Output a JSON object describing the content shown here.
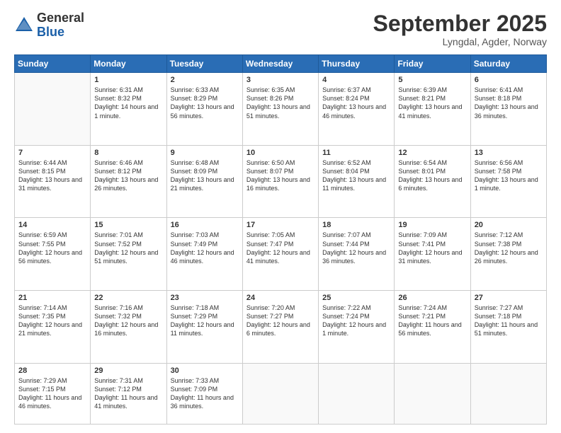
{
  "header": {
    "logo": {
      "general": "General",
      "blue": "Blue"
    },
    "title": "September 2025",
    "location": "Lyngdal, Agder, Norway"
  },
  "days_of_week": [
    "Sunday",
    "Monday",
    "Tuesday",
    "Wednesday",
    "Thursday",
    "Friday",
    "Saturday"
  ],
  "weeks": [
    [
      {
        "day": "",
        "sunrise": "",
        "sunset": "",
        "daylight": ""
      },
      {
        "day": "1",
        "sunrise": "Sunrise: 6:31 AM",
        "sunset": "Sunset: 8:32 PM",
        "daylight": "Daylight: 14 hours and 1 minute."
      },
      {
        "day": "2",
        "sunrise": "Sunrise: 6:33 AM",
        "sunset": "Sunset: 8:29 PM",
        "daylight": "Daylight: 13 hours and 56 minutes."
      },
      {
        "day": "3",
        "sunrise": "Sunrise: 6:35 AM",
        "sunset": "Sunset: 8:26 PM",
        "daylight": "Daylight: 13 hours and 51 minutes."
      },
      {
        "day": "4",
        "sunrise": "Sunrise: 6:37 AM",
        "sunset": "Sunset: 8:24 PM",
        "daylight": "Daylight: 13 hours and 46 minutes."
      },
      {
        "day": "5",
        "sunrise": "Sunrise: 6:39 AM",
        "sunset": "Sunset: 8:21 PM",
        "daylight": "Daylight: 13 hours and 41 minutes."
      },
      {
        "day": "6",
        "sunrise": "Sunrise: 6:41 AM",
        "sunset": "Sunset: 8:18 PM",
        "daylight": "Daylight: 13 hours and 36 minutes."
      }
    ],
    [
      {
        "day": "7",
        "sunrise": "Sunrise: 6:44 AM",
        "sunset": "Sunset: 8:15 PM",
        "daylight": "Daylight: 13 hours and 31 minutes."
      },
      {
        "day": "8",
        "sunrise": "Sunrise: 6:46 AM",
        "sunset": "Sunset: 8:12 PM",
        "daylight": "Daylight: 13 hours and 26 minutes."
      },
      {
        "day": "9",
        "sunrise": "Sunrise: 6:48 AM",
        "sunset": "Sunset: 8:09 PM",
        "daylight": "Daylight: 13 hours and 21 minutes."
      },
      {
        "day": "10",
        "sunrise": "Sunrise: 6:50 AM",
        "sunset": "Sunset: 8:07 PM",
        "daylight": "Daylight: 13 hours and 16 minutes."
      },
      {
        "day": "11",
        "sunrise": "Sunrise: 6:52 AM",
        "sunset": "Sunset: 8:04 PM",
        "daylight": "Daylight: 13 hours and 11 minutes."
      },
      {
        "day": "12",
        "sunrise": "Sunrise: 6:54 AM",
        "sunset": "Sunset: 8:01 PM",
        "daylight": "Daylight: 13 hours and 6 minutes."
      },
      {
        "day": "13",
        "sunrise": "Sunrise: 6:56 AM",
        "sunset": "Sunset: 7:58 PM",
        "daylight": "Daylight: 13 hours and 1 minute."
      }
    ],
    [
      {
        "day": "14",
        "sunrise": "Sunrise: 6:59 AM",
        "sunset": "Sunset: 7:55 PM",
        "daylight": "Daylight: 12 hours and 56 minutes."
      },
      {
        "day": "15",
        "sunrise": "Sunrise: 7:01 AM",
        "sunset": "Sunset: 7:52 PM",
        "daylight": "Daylight: 12 hours and 51 minutes."
      },
      {
        "day": "16",
        "sunrise": "Sunrise: 7:03 AM",
        "sunset": "Sunset: 7:49 PM",
        "daylight": "Daylight: 12 hours and 46 minutes."
      },
      {
        "day": "17",
        "sunrise": "Sunrise: 7:05 AM",
        "sunset": "Sunset: 7:47 PM",
        "daylight": "Daylight: 12 hours and 41 minutes."
      },
      {
        "day": "18",
        "sunrise": "Sunrise: 7:07 AM",
        "sunset": "Sunset: 7:44 PM",
        "daylight": "Daylight: 12 hours and 36 minutes."
      },
      {
        "day": "19",
        "sunrise": "Sunrise: 7:09 AM",
        "sunset": "Sunset: 7:41 PM",
        "daylight": "Daylight: 12 hours and 31 minutes."
      },
      {
        "day": "20",
        "sunrise": "Sunrise: 7:12 AM",
        "sunset": "Sunset: 7:38 PM",
        "daylight": "Daylight: 12 hours and 26 minutes."
      }
    ],
    [
      {
        "day": "21",
        "sunrise": "Sunrise: 7:14 AM",
        "sunset": "Sunset: 7:35 PM",
        "daylight": "Daylight: 12 hours and 21 minutes."
      },
      {
        "day": "22",
        "sunrise": "Sunrise: 7:16 AM",
        "sunset": "Sunset: 7:32 PM",
        "daylight": "Daylight: 12 hours and 16 minutes."
      },
      {
        "day": "23",
        "sunrise": "Sunrise: 7:18 AM",
        "sunset": "Sunset: 7:29 PM",
        "daylight": "Daylight: 12 hours and 11 minutes."
      },
      {
        "day": "24",
        "sunrise": "Sunrise: 7:20 AM",
        "sunset": "Sunset: 7:27 PM",
        "daylight": "Daylight: 12 hours and 6 minutes."
      },
      {
        "day": "25",
        "sunrise": "Sunrise: 7:22 AM",
        "sunset": "Sunset: 7:24 PM",
        "daylight": "Daylight: 12 hours and 1 minute."
      },
      {
        "day": "26",
        "sunrise": "Sunrise: 7:24 AM",
        "sunset": "Sunset: 7:21 PM",
        "daylight": "Daylight: 11 hours and 56 minutes."
      },
      {
        "day": "27",
        "sunrise": "Sunrise: 7:27 AM",
        "sunset": "Sunset: 7:18 PM",
        "daylight": "Daylight: 11 hours and 51 minutes."
      }
    ],
    [
      {
        "day": "28",
        "sunrise": "Sunrise: 7:29 AM",
        "sunset": "Sunset: 7:15 PM",
        "daylight": "Daylight: 11 hours and 46 minutes."
      },
      {
        "day": "29",
        "sunrise": "Sunrise: 7:31 AM",
        "sunset": "Sunset: 7:12 PM",
        "daylight": "Daylight: 11 hours and 41 minutes."
      },
      {
        "day": "30",
        "sunrise": "Sunrise: 7:33 AM",
        "sunset": "Sunset: 7:09 PM",
        "daylight": "Daylight: 11 hours and 36 minutes."
      },
      {
        "day": "",
        "sunrise": "",
        "sunset": "",
        "daylight": ""
      },
      {
        "day": "",
        "sunrise": "",
        "sunset": "",
        "daylight": ""
      },
      {
        "day": "",
        "sunrise": "",
        "sunset": "",
        "daylight": ""
      },
      {
        "day": "",
        "sunrise": "",
        "sunset": "",
        "daylight": ""
      }
    ]
  ]
}
